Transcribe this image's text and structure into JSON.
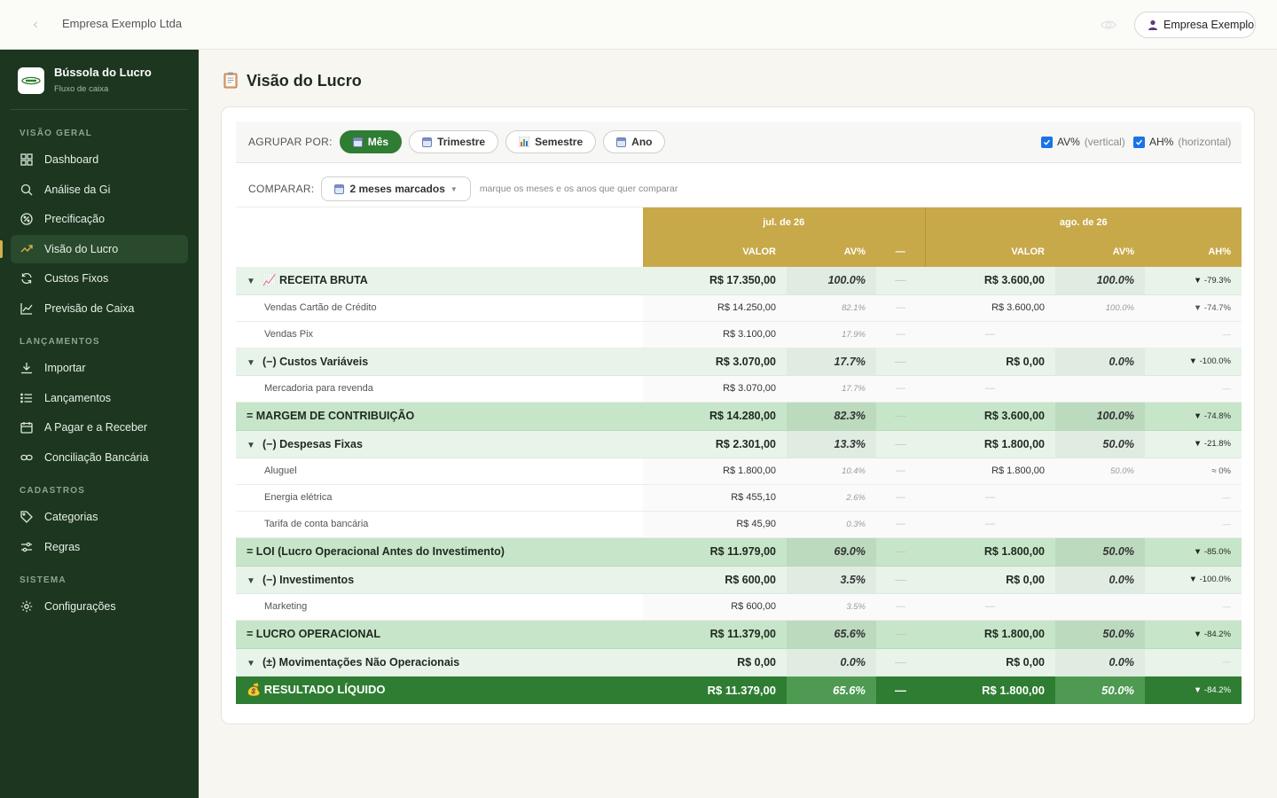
{
  "topbar": {
    "company": "Empresa Exemplo Ltda",
    "user": "Empresa Exemplo"
  },
  "sidebar": {
    "brand_name": "Bússola do Lucro",
    "brand_sub": "Fluxo de caixa",
    "sections": {
      "visao_geral": "VISÃO GERAL",
      "lancamentos": "LANÇAMENTOS",
      "cadastros": "CADASTROS",
      "sistema": "SISTEMA"
    },
    "items": {
      "dashboard": "Dashboard",
      "analise": "Análise da Gi",
      "precificacao": "Precificação",
      "visao_lucro": "Visão do Lucro",
      "custos_fixos": "Custos Fixos",
      "previsao": "Previsão de Caixa",
      "importar": "Importar",
      "lancamentos": "Lançamentos",
      "pagar_receber": "A Pagar e a Receber",
      "conciliacao": "Conciliação Bancária",
      "categorias": "Categorias",
      "regras": "Regras",
      "configuracoes": "Configurações"
    },
    "active": "visao_lucro"
  },
  "page": {
    "title": "Visão do Lucro"
  },
  "controls": {
    "group_label": "AGRUPAR POR:",
    "group_options": [
      "Mês",
      "Trimestre",
      "Semestre",
      "Ano"
    ],
    "group_selected": "Mês",
    "av_label": "AV%",
    "av_sub": "(vertical)",
    "av_checked": true,
    "ah_label": "AH%",
    "ah_sub": "(horizontal)",
    "ah_checked": true,
    "compare_label": "COMPARAR:",
    "compare_value": "2 meses marcados",
    "compare_hint": "marque os meses e os anos que quer comparar"
  },
  "table": {
    "periods": [
      "jul. de 26",
      "ago. de 26"
    ],
    "col_valor": "VALOR",
    "col_av": "AV%",
    "col_dash": "—",
    "col_ah": "AH%",
    "rows": [
      {
        "type": "group",
        "label": "📈 RECEITA BRUTA",
        "v1": "R$ 17.350,00",
        "av1": "100.0%",
        "v2": "R$ 3.600,00",
        "av2": "100.0%",
        "ah": "▼ -79.3%",
        "ah_dir": "down"
      },
      {
        "type": "row",
        "label": "Vendas Cartão de Crédito",
        "v1": "R$ 14.250,00",
        "av1": "82.1%",
        "v2": "R$ 3.600,00",
        "av2": "100.0%",
        "ah": "▼ -74.7%",
        "ah_dir": "down"
      },
      {
        "type": "row",
        "label": "Vendas Pix",
        "v1": "R$ 3.100,00",
        "av1": "17.9%",
        "v2": "—",
        "av2": "",
        "ah": "—",
        "ah_dir": "flat"
      },
      {
        "type": "group",
        "label": "(−) Custos Variáveis",
        "v1": "R$ 3.070,00",
        "av1": "17.7%",
        "v2": "R$ 0,00",
        "av2": "0.0%",
        "ah": "▼ -100.0%",
        "ah_dir": "up"
      },
      {
        "type": "row",
        "label": "Mercadoria para revenda",
        "v1": "R$ 3.070,00",
        "av1": "17.7%",
        "v2": "—",
        "av2": "",
        "ah": "—",
        "ah_dir": "flat"
      },
      {
        "type": "subtotal",
        "label": "= MARGEM DE CONTRIBUIÇÃO",
        "v1": "R$ 14.280,00",
        "av1": "82.3%",
        "v2": "R$ 3.600,00",
        "av2": "100.0%",
        "ah": "▼ -74.8%",
        "ah_dir": "down"
      },
      {
        "type": "group",
        "label": "(−) Despesas Fixas",
        "v1": "R$ 2.301,00",
        "av1": "13.3%",
        "v2": "R$ 1.800,00",
        "av2": "50.0%",
        "ah": "▼ -21.8%",
        "ah_dir": "up"
      },
      {
        "type": "row",
        "label": "Aluguel",
        "v1": "R$ 1.800,00",
        "av1": "10.4%",
        "v2": "R$ 1.800,00",
        "av2": "50.0%",
        "ah": "≈ 0%",
        "ah_dir": "flat"
      },
      {
        "type": "row",
        "label": "Energia elétrica",
        "v1": "R$ 455,10",
        "av1": "2.6%",
        "v2": "—",
        "av2": "",
        "ah": "—",
        "ah_dir": "flat"
      },
      {
        "type": "row",
        "label": "Tarifa de conta bancária",
        "v1": "R$ 45,90",
        "av1": "0.3%",
        "v2": "—",
        "av2": "",
        "ah": "—",
        "ah_dir": "flat"
      },
      {
        "type": "subtotal",
        "label": "= LOI (Lucro Operacional Antes do Investimento)",
        "v1": "R$ 11.979,00",
        "av1": "69.0%",
        "v2": "R$ 1.800,00",
        "av2": "50.0%",
        "ah": "▼ -85.0%",
        "ah_dir": "down"
      },
      {
        "type": "group",
        "label": "(−) Investimentos",
        "v1": "R$ 600,00",
        "av1": "3.5%",
        "v2": "R$ 0,00",
        "av2": "0.0%",
        "ah": "▼ -100.0%",
        "ah_dir": "up"
      },
      {
        "type": "row",
        "label": "Marketing",
        "v1": "R$ 600,00",
        "av1": "3.5%",
        "v2": "—",
        "av2": "",
        "ah": "—",
        "ah_dir": "flat"
      },
      {
        "type": "subtotal",
        "label": "= LUCRO OPERACIONAL",
        "v1": "R$ 11.379,00",
        "av1": "65.6%",
        "v2": "R$ 1.800,00",
        "av2": "50.0%",
        "ah": "▼ -84.2%",
        "ah_dir": "down"
      },
      {
        "type": "group",
        "label": "(±) Movimentações Não Operacionais",
        "v1": "R$ 0,00",
        "av1": "0.0%",
        "v2": "R$ 0,00",
        "av2": "0.0%",
        "ah": "—",
        "ah_dir": "flat"
      },
      {
        "type": "result",
        "label": "💰 RESULTADO LÍQUIDO",
        "v1": "R$ 11.379,00",
        "av1": "65.6%",
        "v2": "R$ 1.800,00",
        "av2": "50.0%",
        "ah": "▼ -84.2%",
        "ah_dir": "down"
      }
    ]
  }
}
